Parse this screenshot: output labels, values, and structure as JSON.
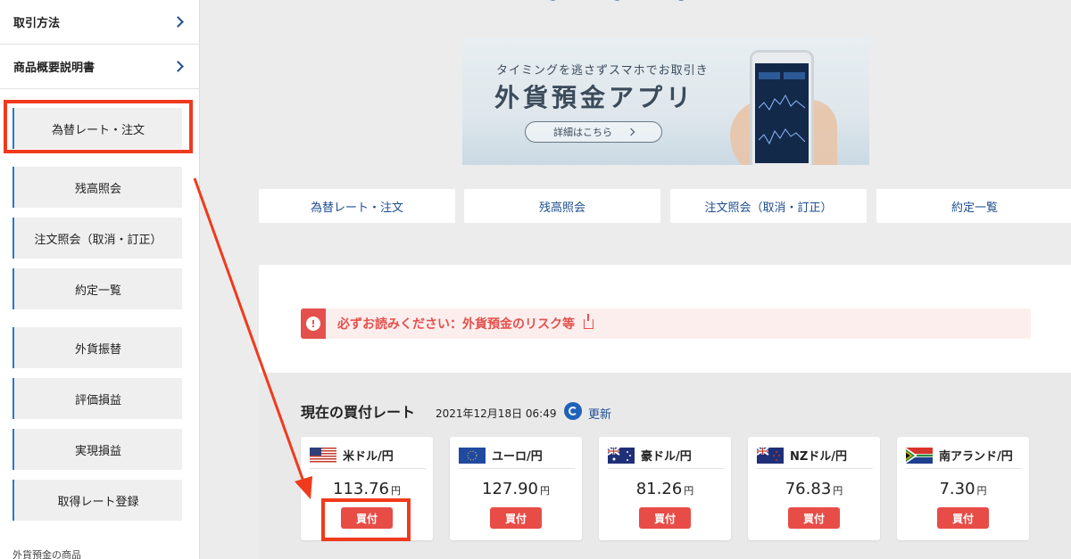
{
  "sidebar": {
    "links": [
      {
        "label": "取引方法"
      },
      {
        "label": "商品概要説明書"
      }
    ],
    "items": [
      {
        "label": "為替レート・注文"
      },
      {
        "label": "残高照会"
      },
      {
        "label": "注文照会（取消・訂正）"
      },
      {
        "label": "約定一覧"
      },
      {
        "label": "外貨振替"
      },
      {
        "label": "評価損益"
      },
      {
        "label": "実現損益"
      },
      {
        "label": "取得レート登録"
      }
    ],
    "footer": "外貨預金の商品"
  },
  "banner": {
    "subtitle": "タイミングを逃さずスマホでお取引き",
    "title": "外貨預金アプリ",
    "button_label": "詳細はこちら"
  },
  "tabs": [
    {
      "label": "為替レート・注文"
    },
    {
      "label": "残高照会"
    },
    {
      "label": "注文照会（取消・訂正）"
    },
    {
      "label": "約定一覧"
    }
  ],
  "notice": {
    "text": "必ずお読みください：外貨預金のリスク等"
  },
  "rates": {
    "title": "現在の買付レート",
    "timestamp": "2021年12月18日 06:49",
    "refresh_label": "更新",
    "unit": "円",
    "buy_label": "買付",
    "cards": [
      {
        "pair": "米ドル/円",
        "rate": "113.76"
      },
      {
        "pair": "ユーロ/円",
        "rate": "127.90"
      },
      {
        "pair": "豪ドル/円",
        "rate": "81.26"
      },
      {
        "pair": "NZドル/円",
        "rate": "76.83"
      },
      {
        "pair": "南アランド/円",
        "rate": "7.30"
      }
    ]
  },
  "colors": {
    "accent_blue": "#1d4e8f",
    "buy_red": "#e84c47",
    "annotation_red": "#f03a1d"
  }
}
